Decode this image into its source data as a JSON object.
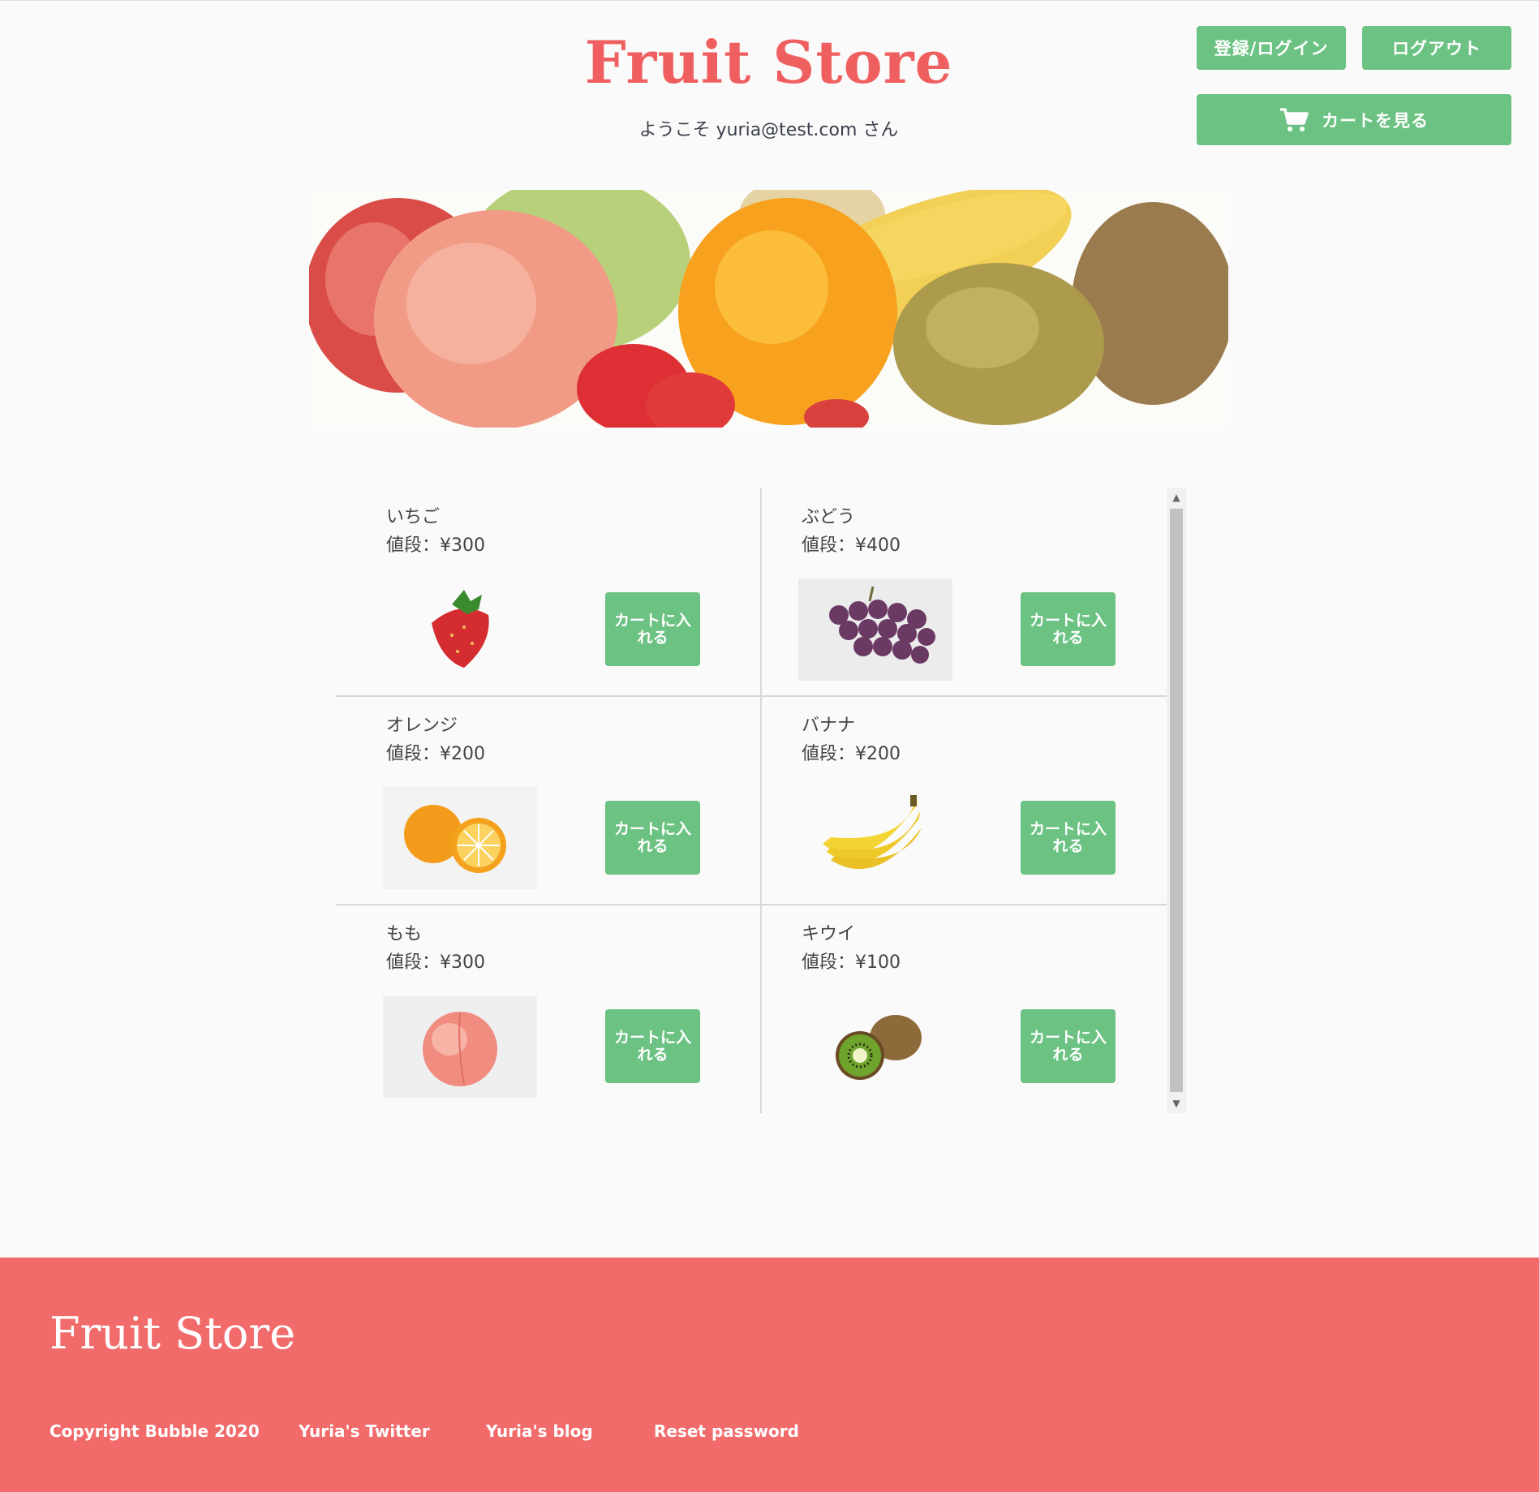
{
  "header": {
    "title": "Fruit Store",
    "welcome": "ようこそ yuria@test.com さん",
    "login_label": "登録/ログイン",
    "logout_label": "ログアウト",
    "cart_label": "カートを見る"
  },
  "products": [
    {
      "name": "いちご",
      "price": "値段：¥300",
      "button": "カートに入れる"
    },
    {
      "name": "ぶどう",
      "price": "値段：¥400",
      "button": "カートに入れる"
    },
    {
      "name": "オレンジ",
      "price": "値段：¥200",
      "button": "カートに入れる"
    },
    {
      "name": "バナナ",
      "price": "値段：¥200",
      "button": "カートに入れる"
    },
    {
      "name": "もも",
      "price": "値段：¥300",
      "button": "カートに入れる"
    },
    {
      "name": "キウイ",
      "price": "値段：¥100",
      "button": "カートに入れる"
    }
  ],
  "footer": {
    "brand": "Fruit Store",
    "links": [
      "Copyright Bubble 2020",
      "Yuria's Twitter",
      "Yuria's blog",
      "Reset password"
    ]
  },
  "colors": {
    "accent_green": "#6cc283",
    "brand_red": "#ef5f5f",
    "footer_bg": "#f26b6b"
  },
  "icons": {
    "cart": "shopping-cart-icon"
  }
}
